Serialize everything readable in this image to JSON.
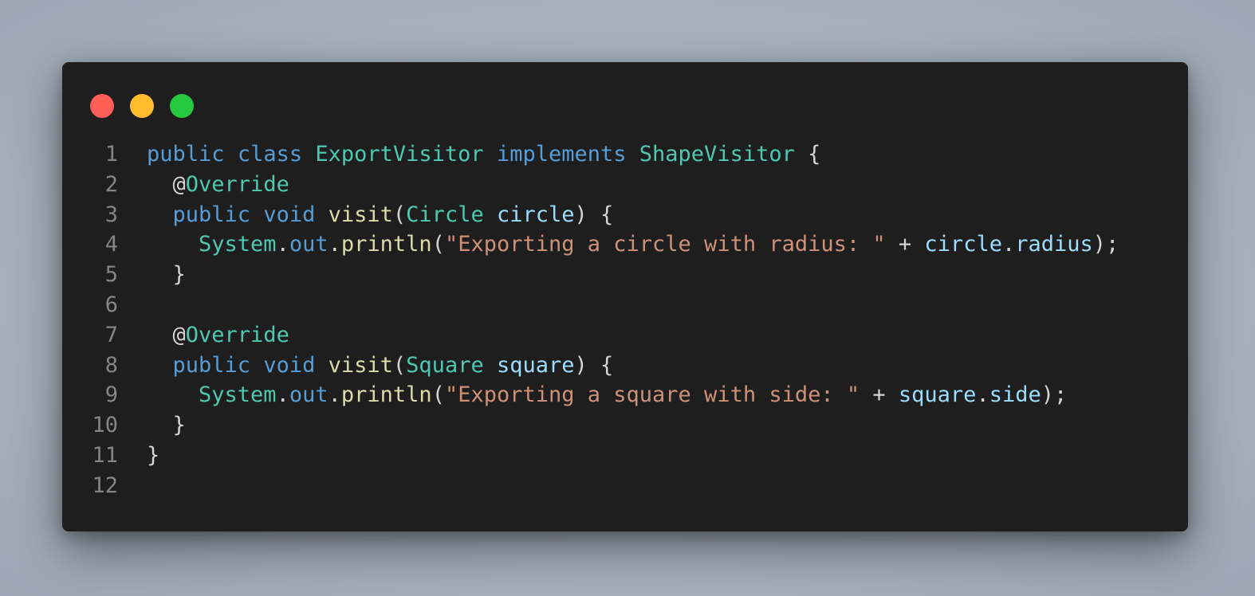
{
  "window": {
    "controls": [
      {
        "name": "close",
        "color": "#ff5f56"
      },
      {
        "name": "minimize",
        "color": "#ffbd2e"
      },
      {
        "name": "maximize",
        "color": "#27c93f"
      }
    ]
  },
  "colors": {
    "keyword": "#569cd6",
    "type": "#4ec9b0",
    "function": "#dcdcaa",
    "variable": "#9cdcfe",
    "string": "#ce9178",
    "plain": "#d4d4d4",
    "line_number": "#858585",
    "background": "#1e1e1e"
  },
  "code": {
    "language": "java",
    "lines": [
      {
        "n": "1",
        "tokens": [
          {
            "t": "public",
            "c": "keyword"
          },
          {
            "t": " ",
            "c": "plain"
          },
          {
            "t": "class",
            "c": "keyword"
          },
          {
            "t": " ",
            "c": "plain"
          },
          {
            "t": "ExportVisitor",
            "c": "type"
          },
          {
            "t": " ",
            "c": "plain"
          },
          {
            "t": "implements",
            "c": "keyword"
          },
          {
            "t": " ",
            "c": "plain"
          },
          {
            "t": "ShapeVisitor",
            "c": "type"
          },
          {
            "t": " {",
            "c": "plain"
          }
        ]
      },
      {
        "n": "2",
        "tokens": [
          {
            "t": "  @",
            "c": "plain"
          },
          {
            "t": "Override",
            "c": "type"
          }
        ]
      },
      {
        "n": "3",
        "tokens": [
          {
            "t": "  ",
            "c": "plain"
          },
          {
            "t": "public",
            "c": "keyword"
          },
          {
            "t": " ",
            "c": "plain"
          },
          {
            "t": "void",
            "c": "keyword"
          },
          {
            "t": " ",
            "c": "plain"
          },
          {
            "t": "visit",
            "c": "function"
          },
          {
            "t": "(",
            "c": "plain"
          },
          {
            "t": "Circle",
            "c": "type"
          },
          {
            "t": " ",
            "c": "plain"
          },
          {
            "t": "circle",
            "c": "variable"
          },
          {
            "t": ") {",
            "c": "plain"
          }
        ]
      },
      {
        "n": "4",
        "tokens": [
          {
            "t": "    ",
            "c": "plain"
          },
          {
            "t": "System",
            "c": "type"
          },
          {
            "t": ".",
            "c": "plain"
          },
          {
            "t": "out",
            "c": "keyword"
          },
          {
            "t": ".",
            "c": "plain"
          },
          {
            "t": "println",
            "c": "function"
          },
          {
            "t": "(",
            "c": "plain"
          },
          {
            "t": "\"Exporting a circle with radius: \"",
            "c": "string"
          },
          {
            "t": " + ",
            "c": "plain"
          },
          {
            "t": "circle",
            "c": "variable"
          },
          {
            "t": ".",
            "c": "plain"
          },
          {
            "t": "radius",
            "c": "variable"
          },
          {
            "t": ");",
            "c": "plain"
          }
        ]
      },
      {
        "n": "5",
        "tokens": [
          {
            "t": "  }",
            "c": "plain"
          }
        ]
      },
      {
        "n": "6",
        "tokens": []
      },
      {
        "n": "7",
        "tokens": [
          {
            "t": "  @",
            "c": "plain"
          },
          {
            "t": "Override",
            "c": "type"
          }
        ]
      },
      {
        "n": "8",
        "tokens": [
          {
            "t": "  ",
            "c": "plain"
          },
          {
            "t": "public",
            "c": "keyword"
          },
          {
            "t": " ",
            "c": "plain"
          },
          {
            "t": "void",
            "c": "keyword"
          },
          {
            "t": " ",
            "c": "plain"
          },
          {
            "t": "visit",
            "c": "function"
          },
          {
            "t": "(",
            "c": "plain"
          },
          {
            "t": "Square",
            "c": "type"
          },
          {
            "t": " ",
            "c": "plain"
          },
          {
            "t": "square",
            "c": "variable"
          },
          {
            "t": ") {",
            "c": "plain"
          }
        ]
      },
      {
        "n": "9",
        "tokens": [
          {
            "t": "    ",
            "c": "plain"
          },
          {
            "t": "System",
            "c": "type"
          },
          {
            "t": ".",
            "c": "plain"
          },
          {
            "t": "out",
            "c": "keyword"
          },
          {
            "t": ".",
            "c": "plain"
          },
          {
            "t": "println",
            "c": "function"
          },
          {
            "t": "(",
            "c": "plain"
          },
          {
            "t": "\"Exporting a square with side: \"",
            "c": "string"
          },
          {
            "t": " + ",
            "c": "plain"
          },
          {
            "t": "square",
            "c": "variable"
          },
          {
            "t": ".",
            "c": "plain"
          },
          {
            "t": "side",
            "c": "variable"
          },
          {
            "t": ");",
            "c": "plain"
          }
        ]
      },
      {
        "n": "10",
        "tokens": [
          {
            "t": "  }",
            "c": "plain"
          }
        ]
      },
      {
        "n": "11",
        "tokens": [
          {
            "t": "}",
            "c": "plain"
          }
        ]
      },
      {
        "n": "12",
        "tokens": []
      }
    ]
  }
}
